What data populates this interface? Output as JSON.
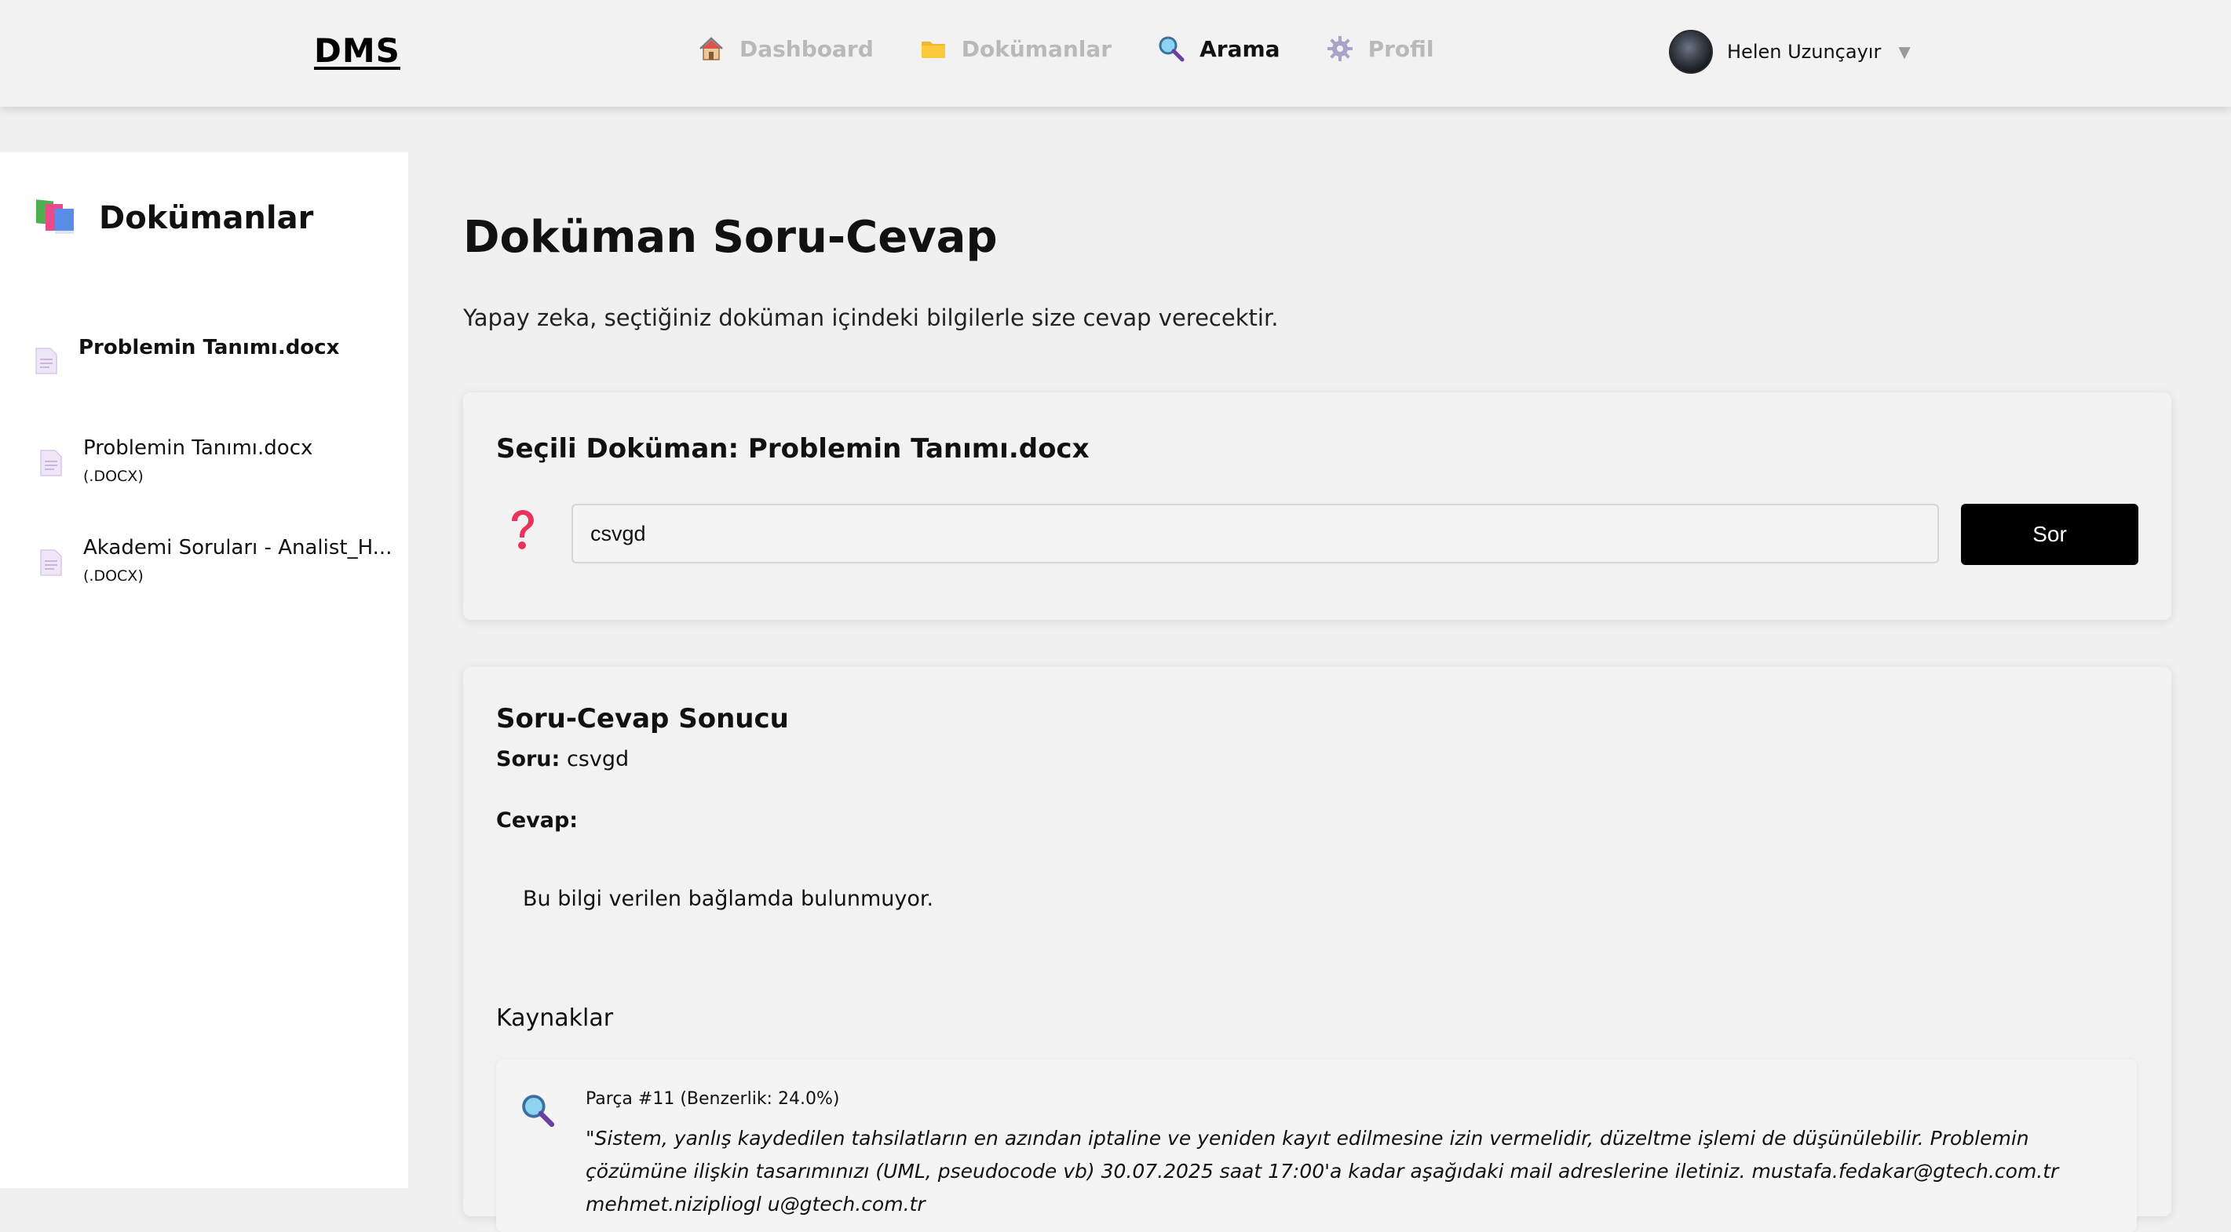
{
  "app": {
    "brand": "DMS"
  },
  "nav": {
    "items": [
      {
        "label": "Dashboard",
        "icon": "house-icon",
        "active": false
      },
      {
        "label": "Dokümanlar",
        "icon": "folder-icon",
        "active": false
      },
      {
        "label": "Arama",
        "icon": "magnifier-icon",
        "active": true
      },
      {
        "label": "Profil",
        "icon": "gear-icon",
        "active": false
      }
    ]
  },
  "user": {
    "name": "Helen Uzunçayır",
    "caret": "▼"
  },
  "sidebar": {
    "title": "Dokümanlar",
    "icon": "books-icon",
    "items": [
      {
        "name": "Problemin Tanımı.docx",
        "ext": "",
        "selected": true
      },
      {
        "name": "Problemin Tanımı.docx",
        "ext": "(.DOCX)",
        "selected": false
      },
      {
        "name": "Akademi Soruları - Analist_H...",
        "ext": "(.DOCX)",
        "selected": false
      }
    ]
  },
  "main": {
    "title": "Doküman Soru-Cevap",
    "subtitle": "Yapay zeka, seçtiğiniz doküman içindeki bilgilerle size cevap verecektir."
  },
  "ask": {
    "selected_label": "Seçili Doküman: Problemin Tanımı.docx",
    "input_value": "csvgd",
    "button_label": "Sor",
    "icon": "question-icon"
  },
  "result": {
    "title": "Soru-Cevap Sonucu",
    "question_label": "Soru:",
    "question_value": "csvgd",
    "answer_label": "Cevap:",
    "answer_text": "Bu bilgi verilen bağlamda bulunmuyor.",
    "sources_title": "Kaynaklar",
    "sources": [
      {
        "meta": "Parça #11 (Benzerlik: 24.0%)",
        "text": "\"Sistem, yanlış kaydedilen tahsilatların en azından iptaline ve yeniden kayıt edilmesine izin vermelidir, düzeltme işlemi de düşünülebilir.   Problemin çözümüne ilişkin tasarımınızı (UML, pseudocode vb) 30.07.2025 saat 17:00'a kadar aşağıdaki mail adreslerine iletiniz.   mustafa.fedakar@gtech.com.tr mehmet.nizipliogl u@gtech.com.tr"
      }
    ]
  },
  "colors": {
    "accent": "#000000",
    "nav_inactive": "#b9b9b9",
    "question_mark": "#e8335a"
  }
}
